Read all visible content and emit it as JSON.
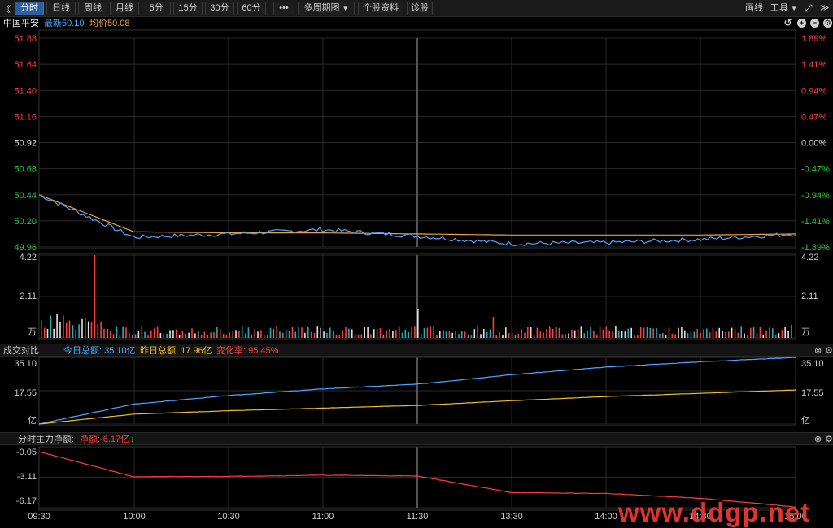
{
  "toolbar": {
    "back_label": "《",
    "tabs": [
      "分时",
      "日线",
      "周线",
      "月线",
      "5分",
      "15分",
      "30分",
      "60分"
    ],
    "more_label": "•••",
    "multi_period_label": "多周期图",
    "stock_info_label": "个股资料",
    "diagnose_label": "诊股",
    "draw_label": "画线",
    "tools_label": "工具",
    "active_tab": "分时"
  },
  "info": {
    "stock_name": "中国平安",
    "latest_label": "最新50.10",
    "avg_label": "均价50.08"
  },
  "price_axis": {
    "left": [
      "51.88",
      "51.64",
      "51.40",
      "51.16",
      "50.92",
      "50.68",
      "50.44",
      "50.20",
      "49.96"
    ],
    "right": [
      "1.89%",
      "1.41%",
      "0.94%",
      "0.47%",
      "0.00%",
      "-0.47%",
      "-0.94%",
      "-1.41%",
      "-1.89%"
    ],
    "colors": {
      "up": "#ff3b3b",
      "flat": "#e0e0e0",
      "down": "#2ecc40"
    }
  },
  "volume_axis": {
    "left": [
      "4.22",
      "2.11",
      "万"
    ],
    "right": [
      "4.22",
      "2.11",
      "万"
    ]
  },
  "turnover_panel": {
    "title": "成交对比",
    "today_label": "今日总额: 35.10亿",
    "yesterday_label": "昨日总额: 17.96亿",
    "change_label": "变化率: 95.45%",
    "axis_left": [
      "35.10",
      "17.55",
      "亿"
    ],
    "axis_right": [
      "35.10",
      "17.55",
      "亿"
    ],
    "today_color": "#4aa8ff",
    "yesterday_color": "#f0c020"
  },
  "netflow_panel": {
    "title": "分时主力净额:",
    "net_label": "净额:-6.17亿",
    "axis_left": [
      "-0.05",
      "-3.11",
      "-6.17"
    ],
    "line_color": "#ff3b3b"
  },
  "time_axis": [
    "09:30",
    "10:00",
    "10:30",
    "11:00",
    "11:30",
    "13:30",
    "14:00",
    "14:30",
    "15:00"
  ],
  "watermark": "www.ddgp.net",
  "chart_data": {
    "type": "line",
    "x": [
      "09:30",
      "10:00",
      "10:30",
      "11:00",
      "11:30",
      "13:30",
      "14:00",
      "14:30",
      "15:00"
    ],
    "series": [
      {
        "name": "最新",
        "values": [
          50.44,
          50.05,
          50.08,
          50.12,
          50.06,
          49.99,
          50.0,
          50.03,
          50.08
        ],
        "color": "#4aa8ff"
      },
      {
        "name": "均价",
        "values": [
          50.44,
          50.1,
          50.09,
          50.09,
          50.08,
          50.07,
          50.07,
          50.07,
          50.08
        ],
        "color": "#f0a040"
      }
    ],
    "ylim": [
      49.96,
      51.88
    ],
    "prev_close": 50.92
  }
}
